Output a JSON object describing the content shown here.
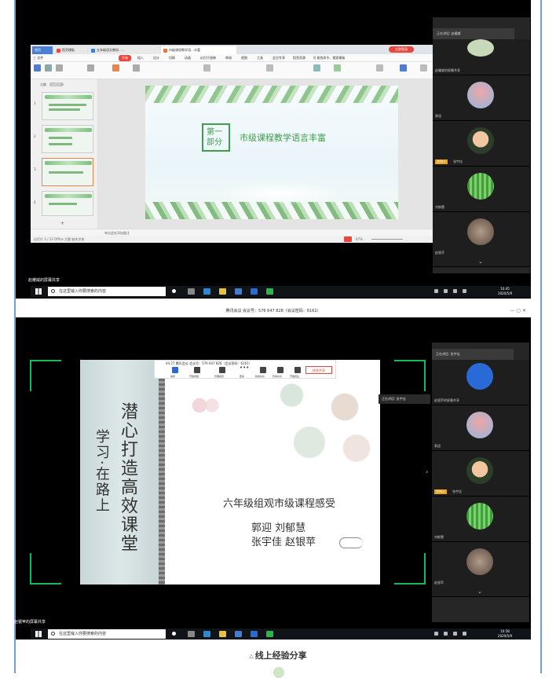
{
  "shot1": {
    "wps_tabs": [
      "首页",
      "稻壳模板",
      "五年级语文教研……",
      "市级课程教学语…丰富"
    ],
    "red_button": "立即登录",
    "menu": [
      "三 文件",
      "开始",
      "插入",
      "设计",
      "切换",
      "动画",
      "幻灯片放映",
      "审阅",
      "视图",
      "工具",
      "会员专享",
      "稻壳资源",
      "Q 查找命令、搜索模板"
    ],
    "thumb_tabs": [
      "大纲",
      "幻灯片"
    ],
    "thumb_numbers": [
      "1",
      "2",
      "3",
      "4"
    ],
    "thumb_add": "+",
    "slide": {
      "part_label": "第一部分",
      "title": "市级课程教学语言丰富"
    },
    "status_left": "幻灯片 3 / 23   Office 主题   缺失字体",
    "status_note": "单击此处添加备注",
    "status_zoom": "67%",
    "speaker": "正在讲话: 赵耀威",
    "tiles": [
      {
        "name": "赵耀威的屏幕共享",
        "host": false
      },
      {
        "name": "郭迎",
        "host": false
      },
      {
        "name": "张宇佳",
        "host": true
      },
      {
        "name": "刘郁慧",
        "host": false
      },
      {
        "name": "赵银苹",
        "host": false
      }
    ],
    "host_label": "主持人",
    "share_label": "赵耀威的屏幕共享",
    "search_placeholder": "在这里输入你要搜索的内容",
    "time": "10:45",
    "date": "2020/5/9"
  },
  "shot2": {
    "title_bar": "腾讯会议 会议号：576 647 828（会议密码：6161）",
    "window_controls": "—  ▢  ✕",
    "toolbar": {
      "header": "44:27  腾讯会议 会议号：576 647 828（会议密码：6161）",
      "items": [
        "静音",
        "开启视频",
        "管理成员",
        "更多",
        "新的共享",
        "暂停共享",
        "开始批注"
      ],
      "end_share": "结束共享"
    },
    "speak_pop": "正在讲话: 张宇佳",
    "scroll_big": "潜心打造高效课堂",
    "scroll_small": "学习·在路上",
    "slide_title": "六年级组观市级课程感受",
    "names_line1": "郭迎    刘郁慧",
    "names_line2": "张宇佳  赵银苹",
    "speaker": "正在讲话: 张宇佳",
    "tiles": [
      {
        "name": "赵银苹的屏幕共享",
        "host": false
      },
      {
        "name": "郭迎",
        "host": false
      },
      {
        "name": "张宇佳",
        "host": true
      },
      {
        "name": "刘郁慧",
        "host": false
      },
      {
        "name": "赵银苹",
        "host": false
      }
    ],
    "host_label": "主持人",
    "share_label": "赵银苹的屏幕共享",
    "search_placeholder": "在这里输入你要搜索的内容",
    "time": "10:58",
    "date": "2020/5/9"
  },
  "caption": "线上经验分享",
  "caption_marker": "△",
  "colors": {
    "accent_red": "#e8473d",
    "host_orange": "#e8a21d",
    "meeting_green": "#16b85a",
    "slide_green": "#3e9e4b"
  }
}
